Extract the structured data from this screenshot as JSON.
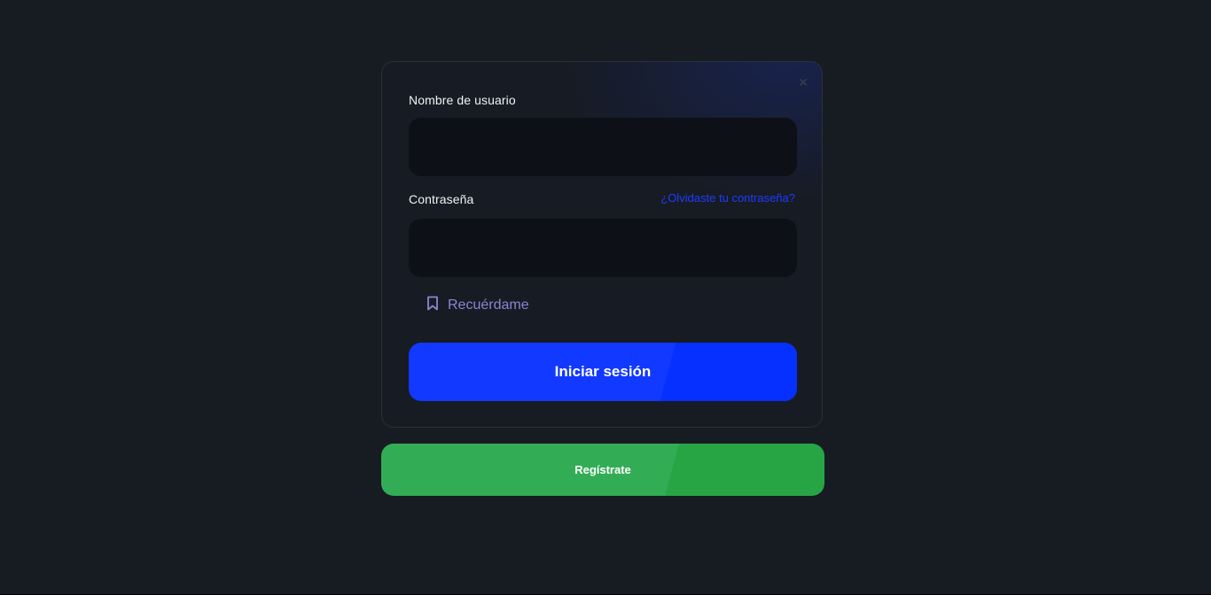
{
  "login_card": {
    "close_icon": "close-icon",
    "username_label": "Nombre de usuario",
    "username_value": "",
    "password_label": "Contraseña",
    "password_value": "",
    "forgot_link": "¿Olvidaste tu contraseña?",
    "remember_icon": "bookmark-icon",
    "remember_label": "Recuérdame",
    "login_button": "Iniciar sesión"
  },
  "register_button": "Regístrate",
  "colors": {
    "background": "#171b22",
    "input_bg": "#0d1016",
    "accent_blue": "#1239ff",
    "link_blue": "#1d3cff",
    "register_green": "#33ad55",
    "remember_purple": "#8a86d4"
  }
}
